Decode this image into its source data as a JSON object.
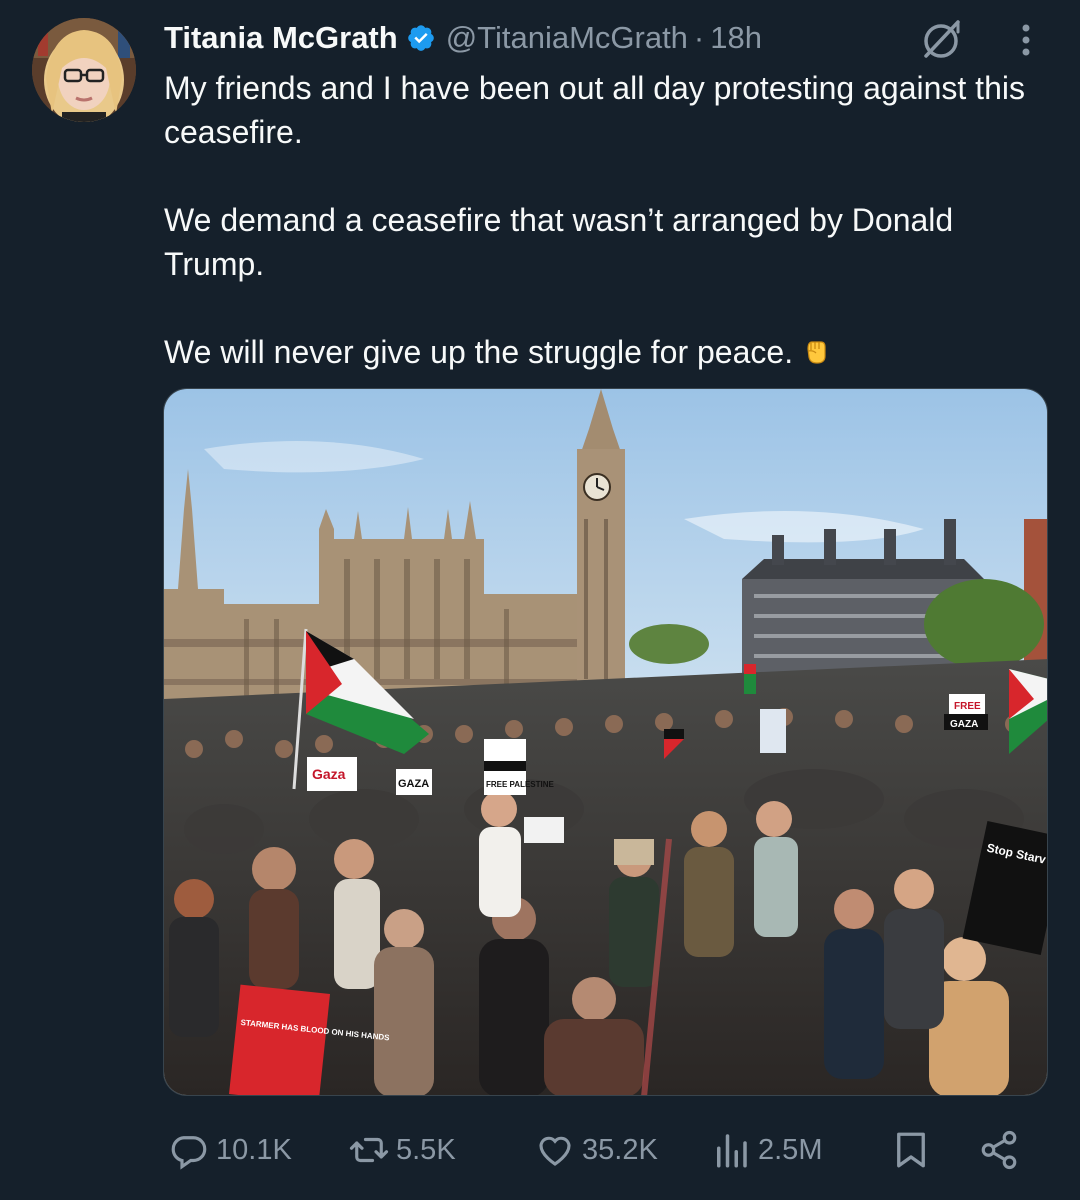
{
  "tweet": {
    "author": {
      "name": "Titania McGrath",
      "handle": "@TitaniaMcGrath",
      "verified": true,
      "verified_color": "#1d9bf0"
    },
    "time": "18h",
    "separator": "·",
    "paragraphs": [
      "My friends and I have been out all day protesting against this ceasefire.",
      "We demand a ceasefire that wasn’t arranged by Donald Trump.",
      "We will never give up the struggle for peace."
    ],
    "emoji": "raised-fist-emoji",
    "photo": {
      "signs": [
        "Gaza",
        "FREE PALESTINE",
        "GAZA",
        "Stop Starv GAZA",
        "STARMER HAS BLOOD ON HIS HANDS",
        "FREE",
        "GAZA"
      ]
    },
    "actions": {
      "replies": "10.1K",
      "reposts": "5.5K",
      "likes": "35.2K",
      "views": "2.5M"
    },
    "icons": [
      "grok-icon",
      "more-icon",
      "reply-icon",
      "repost-icon",
      "like-icon",
      "views-icon",
      "bookmark-icon",
      "share-icon"
    ]
  },
  "colors": {
    "background": "#15202b",
    "text": "#f7f9f9",
    "secondary": "#8b98a5"
  }
}
